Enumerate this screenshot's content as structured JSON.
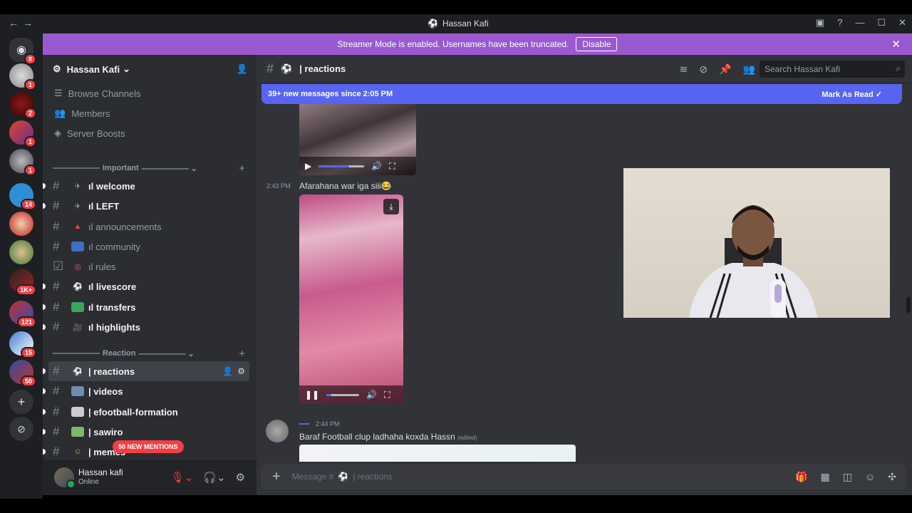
{
  "window": {
    "title": "Hassan Kafi",
    "back": "←",
    "forward": "→"
  },
  "banner": {
    "text": "Streamer Mode is enabled. Usernames have been truncated.",
    "disable": "Disable"
  },
  "servers": {
    "dm_badge": "8",
    "badges": [
      "1",
      "2",
      "1",
      "1",
      "14",
      "1K+",
      "121",
      "15",
      "50"
    ]
  },
  "server": {
    "name": "Hassan Kafi"
  },
  "nav": [
    {
      "label": "Browse Channels"
    },
    {
      "label": "Members"
    },
    {
      "label": "Server Boosts"
    }
  ],
  "categories": {
    "important": "Important",
    "reaction": "Reaction"
  },
  "channels": [
    {
      "name": "welcome",
      "prefix": "ıl "
    },
    {
      "name": "LEFT",
      "prefix": "ıl "
    },
    {
      "name": "announcements",
      "prefix": "ıl "
    },
    {
      "name": "community",
      "prefix": "ıl "
    },
    {
      "name": "rules",
      "prefix": "ıl "
    },
    {
      "name": "livescore",
      "prefix": "ıl "
    },
    {
      "name": "transfers",
      "prefix": "ıl "
    },
    {
      "name": "highlights",
      "prefix": "ıl "
    },
    {
      "name": "reactions",
      "prefix": "| "
    },
    {
      "name": "videos",
      "prefix": "| "
    },
    {
      "name": "efootball-formation",
      "prefix": "| "
    },
    {
      "name": "sawiro",
      "prefix": "| "
    },
    {
      "name": "memes",
      "prefix": "| "
    }
  ],
  "mentions_pill": "50 NEW MENTIONS",
  "user": {
    "name": "Hassan kafi",
    "status": "Online"
  },
  "channel_header": {
    "name": "| reactions",
    "search_placeholder": "Search Hassan Kafi"
  },
  "new_messages": {
    "text": "39+ new messages since 2:05 PM",
    "mark": "Mark As Read"
  },
  "messages": [
    {
      "time": "2:43 PM",
      "text": "Afarahana war iga siii😂"
    },
    {
      "time": "2:44 PM",
      "text": "Baraf Football clup ladhaha koxda Hassn",
      "edited": "(edited)"
    }
  ],
  "video1": {
    "progress": 0.67
  },
  "video2": {
    "progress": 0.15
  },
  "composer": {
    "placeholder_prefix": "Message #",
    "placeholder_channel": "| reactions"
  },
  "colors": {
    "accent": "#5865f2",
    "banner": "#9b59d0",
    "danger": "#f23f43",
    "online": "#23a55a"
  }
}
